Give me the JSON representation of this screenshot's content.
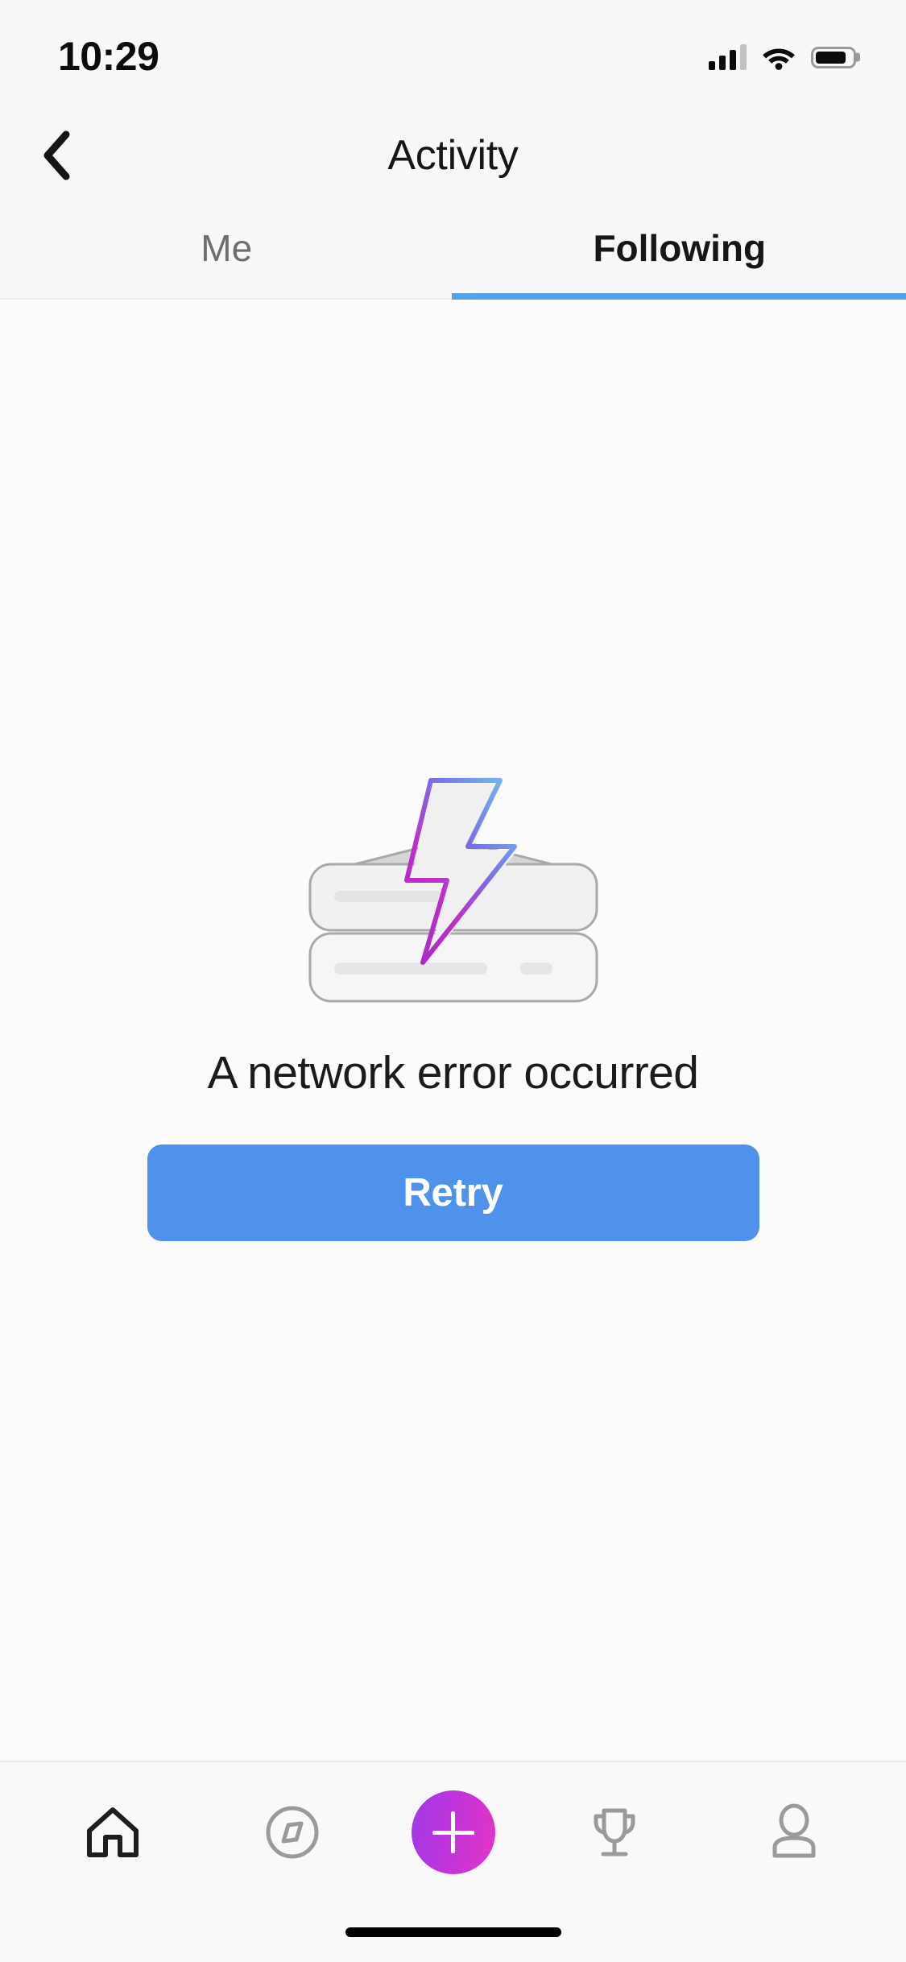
{
  "status_bar": {
    "time": "10:29",
    "signal_icon": "cellular-signal-icon",
    "signal_bars_filled": 3,
    "signal_bars_total": 4,
    "wifi_icon": "wifi-icon",
    "battery_icon": "battery-icon",
    "battery_level_percent": 85
  },
  "header": {
    "back_icon": "chevron-left-icon",
    "title": "Activity"
  },
  "tabs": {
    "items": [
      {
        "label": "Me",
        "active": false
      },
      {
        "label": "Following",
        "active": true
      }
    ],
    "indicator_color": "#52a2ee"
  },
  "main": {
    "illustration_name": "network-error-illustration",
    "error_message": "A network error occurred",
    "retry_label": "Retry",
    "retry_color": "#4f92ec",
    "bolt_gradient_start": "#b02ec0",
    "bolt_gradient_end": "#6fc5f0"
  },
  "bottom_nav": {
    "items": [
      {
        "icon": "home-icon",
        "name": "nav-home",
        "active": true
      },
      {
        "icon": "compass-icon",
        "name": "nav-discover",
        "active": false
      },
      {
        "icon": "plus-icon",
        "name": "nav-create",
        "active": false
      },
      {
        "icon": "trophy-icon",
        "name": "nav-rewards",
        "active": false
      },
      {
        "icon": "person-icon",
        "name": "nav-profile",
        "active": false
      }
    ],
    "fab_gradient_start": "#9e3ae8",
    "fab_gradient_end": "#e534c5"
  },
  "home_indicator": {
    "name": "home-indicator"
  }
}
